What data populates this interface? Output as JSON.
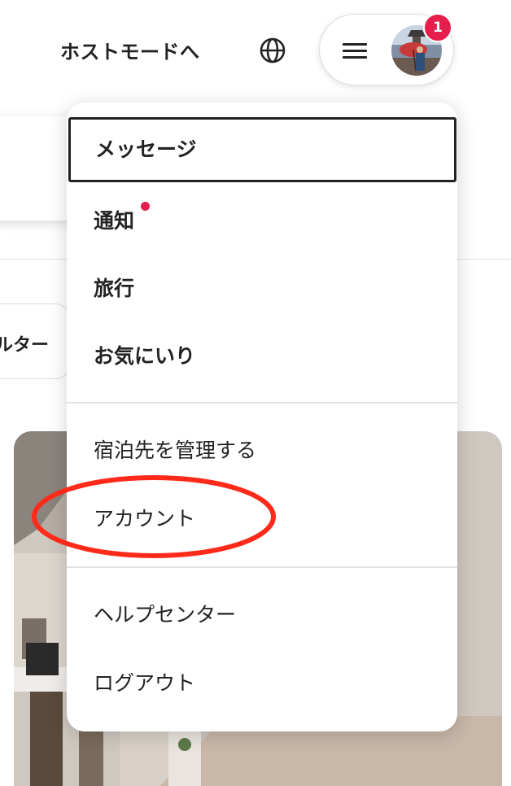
{
  "header": {
    "host_mode_label": "ホストモードへ",
    "language_icon": "globe-icon",
    "menu_icon": "hamburger-menu-icon",
    "notification_count": "1"
  },
  "background": {
    "filter_label": "ルター"
  },
  "menu": {
    "items": [
      {
        "label": "メッセージ",
        "bold": true,
        "focused": true
      },
      {
        "label": "通知",
        "bold": true,
        "has_dot": true
      },
      {
        "label": "旅行",
        "bold": true
      },
      {
        "label": "お気にいり",
        "bold": true
      },
      {
        "label": "宿泊先を管理する",
        "bold": false
      },
      {
        "label": "アカウント",
        "bold": false,
        "annotated": true
      },
      {
        "label": "ヘルプセンター",
        "bold": false
      },
      {
        "label": "ログアウト",
        "bold": false
      }
    ]
  },
  "colors": {
    "accent": "#e61e4d",
    "text": "#222222",
    "annotation": "#ff2a1a",
    "divider": "#e2e2e2"
  }
}
